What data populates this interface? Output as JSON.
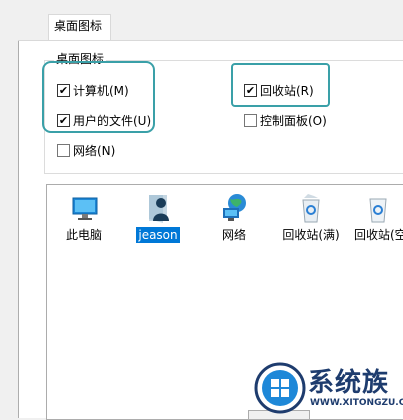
{
  "tab": {
    "label": "桌面图标"
  },
  "group": {
    "title": "桌面图标"
  },
  "checkboxes": [
    {
      "label": "计算机(M)",
      "checked": true
    },
    {
      "label": "回收站(R)",
      "checked": true
    },
    {
      "label": "用户的文件(U)",
      "checked": true
    },
    {
      "label": "控制面板(O)",
      "checked": false
    },
    {
      "label": "网络(N)",
      "checked": false
    }
  ],
  "icons": [
    {
      "label": "此电脑",
      "icon": "computer-icon",
      "selected": false
    },
    {
      "label": "jeason",
      "icon": "user-folder-icon",
      "selected": true
    },
    {
      "label": "网络",
      "icon": "network-icon",
      "selected": false
    },
    {
      "label": "回收站(满)",
      "icon": "recycle-bin-full-icon",
      "selected": false
    },
    {
      "label": "回收站(空",
      "icon": "recycle-bin-empty-icon",
      "selected": false
    }
  ],
  "watermark": {
    "brand": "系统族",
    "url": "WWW.XITONGZU.COM"
  },
  "colors": {
    "highlight": "#3aa0a8",
    "selection": "#0078d7",
    "brand": "#1e3c6e"
  }
}
